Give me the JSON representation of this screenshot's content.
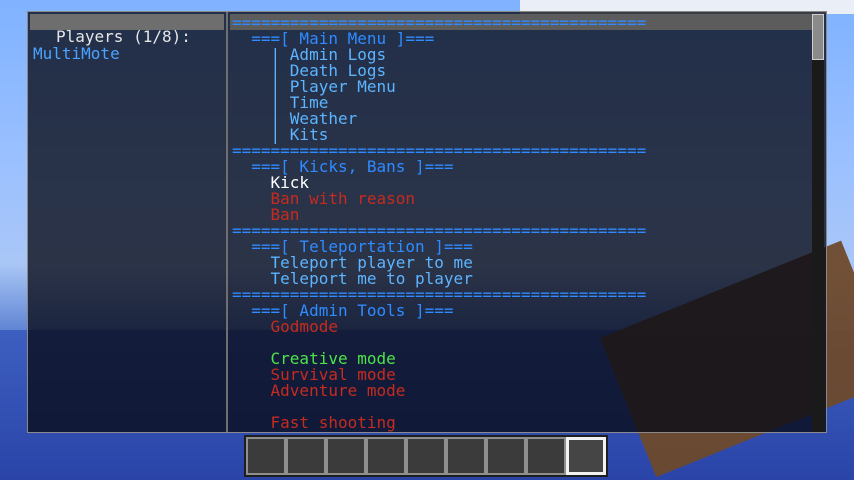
{
  "players_panel": {
    "title": "Players (1/8):",
    "players": [
      "MultiMote"
    ]
  },
  "menu": {
    "lines": [
      {
        "text": "===========================================",
        "color": "#2f8bff",
        "kind": "separator"
      },
      {
        "text": "  ===[ Main Menu ]===",
        "color": "#2f8bff",
        "kind": "header"
      },
      {
        "text": "    | Admin Logs",
        "color": "#5db4ff",
        "kind": "item"
      },
      {
        "text": "    | Death Logs",
        "color": "#5db4ff",
        "kind": "item"
      },
      {
        "text": "    | Player Menu",
        "color": "#5db4ff",
        "kind": "item"
      },
      {
        "text": "    | Time",
        "color": "#5db4ff",
        "kind": "item"
      },
      {
        "text": "    | Weather",
        "color": "#5db4ff",
        "kind": "item"
      },
      {
        "text": "    | Kits",
        "color": "#5db4ff",
        "kind": "item"
      },
      {
        "text": "===========================================",
        "color": "#2f8bff",
        "kind": "separator"
      },
      {
        "text": "  ===[ Kicks, Bans ]===",
        "color": "#2f8bff",
        "kind": "header"
      },
      {
        "text": "    Kick",
        "color": "#ffffff",
        "kind": "item"
      },
      {
        "text": "    Ban with reason",
        "color": "#c62b1f",
        "kind": "item"
      },
      {
        "text": "    Ban",
        "color": "#c62b1f",
        "kind": "item"
      },
      {
        "text": "===========================================",
        "color": "#2f8bff",
        "kind": "separator"
      },
      {
        "text": "  ===[ Teleportation ]===",
        "color": "#2f8bff",
        "kind": "header"
      },
      {
        "text": "    Teleport player to me",
        "color": "#5db4ff",
        "kind": "item"
      },
      {
        "text": "    Teleport me to player",
        "color": "#5db4ff",
        "kind": "item"
      },
      {
        "text": "===========================================",
        "color": "#2f8bff",
        "kind": "separator"
      },
      {
        "text": "  ===[ Admin Tools ]===",
        "color": "#2f8bff",
        "kind": "header"
      },
      {
        "text": "    Godmode",
        "color": "#c62b1f",
        "kind": "item"
      },
      {
        "text": "",
        "color": "#c62b1f",
        "kind": "spacer"
      },
      {
        "text": "    Creative mode",
        "color": "#4de34a",
        "kind": "item"
      },
      {
        "text": "    Survival mode",
        "color": "#c62b1f",
        "kind": "item"
      },
      {
        "text": "    Adventure mode",
        "color": "#c62b1f",
        "kind": "item"
      },
      {
        "text": "",
        "color": "#c62b1f",
        "kind": "spacer"
      },
      {
        "text": "    Fast shooting",
        "color": "#c62b1f",
        "kind": "item"
      }
    ]
  },
  "hotbar": {
    "slots": 9,
    "selected_slot": 9
  }
}
